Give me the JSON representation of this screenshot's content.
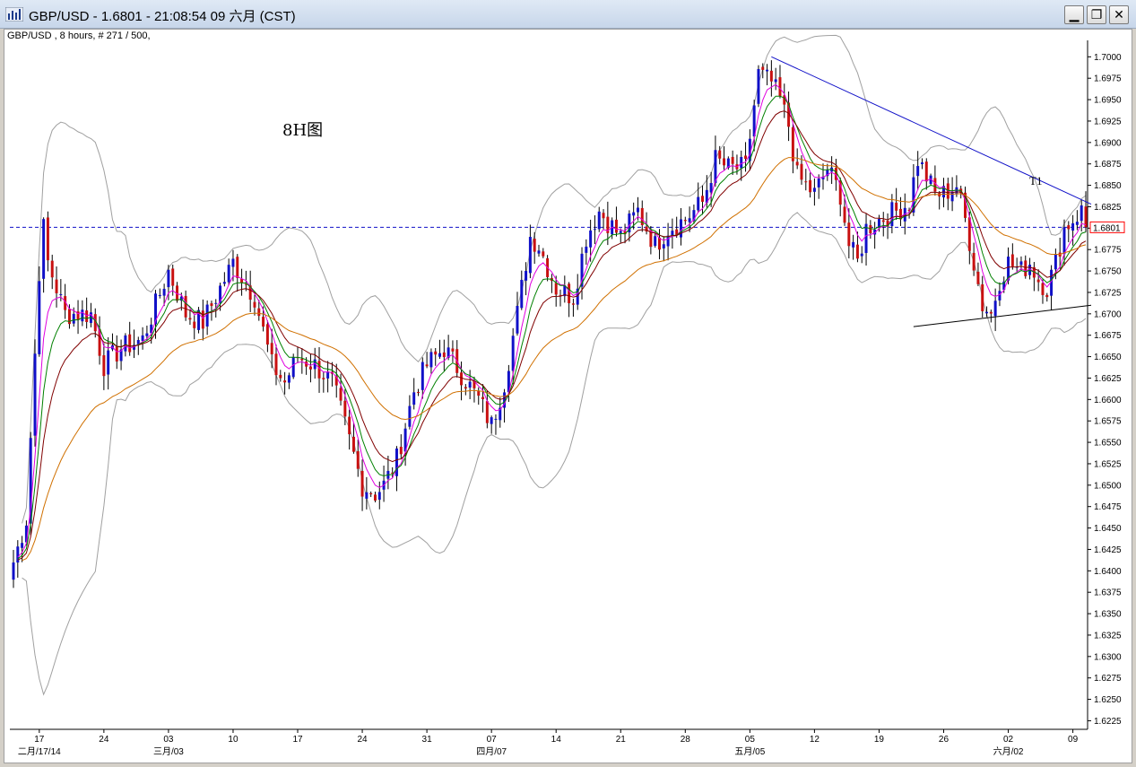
{
  "window": {
    "title": "GBP/USD - 1.6801 - 21:08:54  09 六月 (CST)",
    "minimize_label": "▁",
    "restore_label": "❐",
    "close_label": "✕"
  },
  "chart_info": "GBP/USD , 8 hours, # 271 / 500,",
  "colors": {
    "up_candle": "#1010c8",
    "down_candle": "#c81010",
    "bollinger": "#a0a0a0",
    "ma_fast": "#e000e0",
    "ma_mid": "#008000",
    "ma_slow": "#800000",
    "ma_long": "#d07000",
    "resistance_line": "#1010c8",
    "support_line": "#000000",
    "price_line": "#1010c8",
    "price_label": "#ff0000"
  },
  "chart_data": {
    "type": "candlestick",
    "symbol": "GBP/USD",
    "timeframe": "8 hours",
    "annotation": "8H图",
    "t1_label": "T1",
    "current_price": 1.6801,
    "current_price_label": "1.6801",
    "ylim": [
      1.6215,
      1.7015
    ],
    "y_ticks": [
      1.6225,
      1.625,
      1.6275,
      1.63,
      1.6325,
      1.635,
      1.6375,
      1.64,
      1.6425,
      1.645,
      1.6475,
      1.65,
      1.6525,
      1.655,
      1.6575,
      1.66,
      1.6625,
      1.665,
      1.6675,
      1.67,
      1.6725,
      1.675,
      1.6775,
      1.68,
      1.6825,
      1.685,
      1.6875,
      1.69,
      1.6925,
      1.695,
      1.6975,
      1.7
    ],
    "y_tick_labels": [
      "1.6225",
      "1.6250",
      "1.6275",
      "1.6300",
      "1.6325",
      "1.6350",
      "1.6375",
      "1.6400",
      "1.6425",
      "1.6450",
      "1.6475",
      "1.6500",
      "1.6525",
      "1.6550",
      "1.6575",
      "1.6600",
      "1.6625",
      "1.6650",
      "1.6675",
      "1.6700",
      "1.6725",
      "1.6750",
      "1.6775",
      "1.6800",
      "1.6825",
      "1.6850",
      "1.6875",
      "1.6900",
      "1.6925",
      "1.6950",
      "1.6975",
      "1.7000"
    ],
    "x_ticks": [
      {
        "label": "17",
        "date_label": "二月/17/14",
        "bar": 6
      },
      {
        "label": "24",
        "date_label": "",
        "bar": 21
      },
      {
        "label": "03",
        "date_label": "三月/03",
        "bar": 36
      },
      {
        "label": "10",
        "date_label": "",
        "bar": 51
      },
      {
        "label": "17",
        "date_label": "",
        "bar": 66
      },
      {
        "label": "24",
        "date_label": "",
        "bar": 81
      },
      {
        "label": "31",
        "date_label": "",
        "bar": 96
      },
      {
        "label": "07",
        "date_label": "四月/07",
        "bar": 111
      },
      {
        "label": "14",
        "date_label": "",
        "bar": 126
      },
      {
        "label": "21",
        "date_label": "",
        "bar": 141
      },
      {
        "label": "28",
        "date_label": "",
        "bar": 156
      },
      {
        "label": "05",
        "date_label": "五月/05",
        "bar": 171
      },
      {
        "label": "12",
        "date_label": "",
        "bar": 186
      },
      {
        "label": "19",
        "date_label": "",
        "bar": 201
      },
      {
        "label": "26",
        "date_label": "",
        "bar": 216
      },
      {
        "label": "02",
        "date_label": "六月/02",
        "bar": 231
      },
      {
        "label": "09",
        "date_label": "",
        "bar": 246
      }
    ],
    "bar_count": 250,
    "key_closes": [
      [
        0,
        1.641
      ],
      [
        3,
        1.646
      ],
      [
        6,
        1.675
      ],
      [
        7,
        1.68
      ],
      [
        8,
        1.676
      ],
      [
        12,
        1.67
      ],
      [
        18,
        1.67
      ],
      [
        21,
        1.664
      ],
      [
        25,
        1.666
      ],
      [
        30,
        1.667
      ],
      [
        36,
        1.675
      ],
      [
        40,
        1.67
      ],
      [
        44,
        1.669
      ],
      [
        51,
        1.676
      ],
      [
        56,
        1.672
      ],
      [
        60,
        1.664
      ],
      [
        63,
        1.662
      ],
      [
        66,
        1.665
      ],
      [
        70,
        1.664
      ],
      [
        74,
        1.662
      ],
      [
        77,
        1.657
      ],
      [
        81,
        1.65
      ],
      [
        84,
        1.649
      ],
      [
        86,
        1.65
      ],
      [
        89,
        1.653
      ],
      [
        93,
        1.661
      ],
      [
        96,
        1.664
      ],
      [
        100,
        1.666
      ],
      [
        104,
        1.663
      ],
      [
        108,
        1.66
      ],
      [
        111,
        1.657
      ],
      [
        114,
        1.662
      ],
      [
        117,
        1.67
      ],
      [
        120,
        1.679
      ],
      [
        122,
        1.678
      ],
      [
        126,
        1.673
      ],
      [
        130,
        1.672
      ],
      [
        133,
        1.679
      ],
      [
        136,
        1.682
      ],
      [
        141,
        1.679
      ],
      [
        145,
        1.682
      ],
      [
        149,
        1.678
      ],
      [
        152,
        1.68
      ],
      [
        156,
        1.681
      ],
      [
        160,
        1.683
      ],
      [
        163,
        1.688
      ],
      [
        166,
        1.687
      ],
      [
        170,
        1.687
      ],
      [
        173,
        1.698
      ],
      [
        176,
        1.697
      ],
      [
        178,
        1.695
      ],
      [
        180,
        1.692
      ],
      [
        182,
        1.686
      ],
      [
        184,
        1.685
      ],
      [
        186,
        1.684
      ],
      [
        189,
        1.687
      ],
      [
        192,
        1.684
      ],
      [
        194,
        1.678
      ],
      [
        196,
        1.676
      ],
      [
        198,
        1.68
      ],
      [
        201,
        1.681
      ],
      [
        205,
        1.682
      ],
      [
        208,
        1.683
      ],
      [
        210,
        1.688
      ],
      [
        212,
        1.686
      ],
      [
        214,
        1.684
      ],
      [
        216,
        1.684
      ],
      [
        219,
        1.685
      ],
      [
        221,
        1.681
      ],
      [
        223,
        1.676
      ],
      [
        225,
        1.671
      ],
      [
        227,
        1.67
      ],
      [
        229,
        1.674
      ],
      [
        231,
        1.676
      ],
      [
        234,
        1.675
      ],
      [
        236,
        1.676
      ],
      [
        238,
        1.674
      ],
      [
        240,
        1.673
      ],
      [
        242,
        1.676
      ],
      [
        244,
        1.68
      ],
      [
        246,
        1.681
      ],
      [
        248,
        1.682
      ],
      [
        249,
        1.6801
      ]
    ],
    "resistance_line": {
      "from": {
        "bar": 176,
        "price": 1.7
      },
      "to": {
        "bar": 249,
        "price": 1.6827
      }
    },
    "support_line": {
      "from": {
        "bar": 209,
        "price": 1.6685
      },
      "to": {
        "bar": 249,
        "price": 1.671
      }
    },
    "grid": false
  }
}
